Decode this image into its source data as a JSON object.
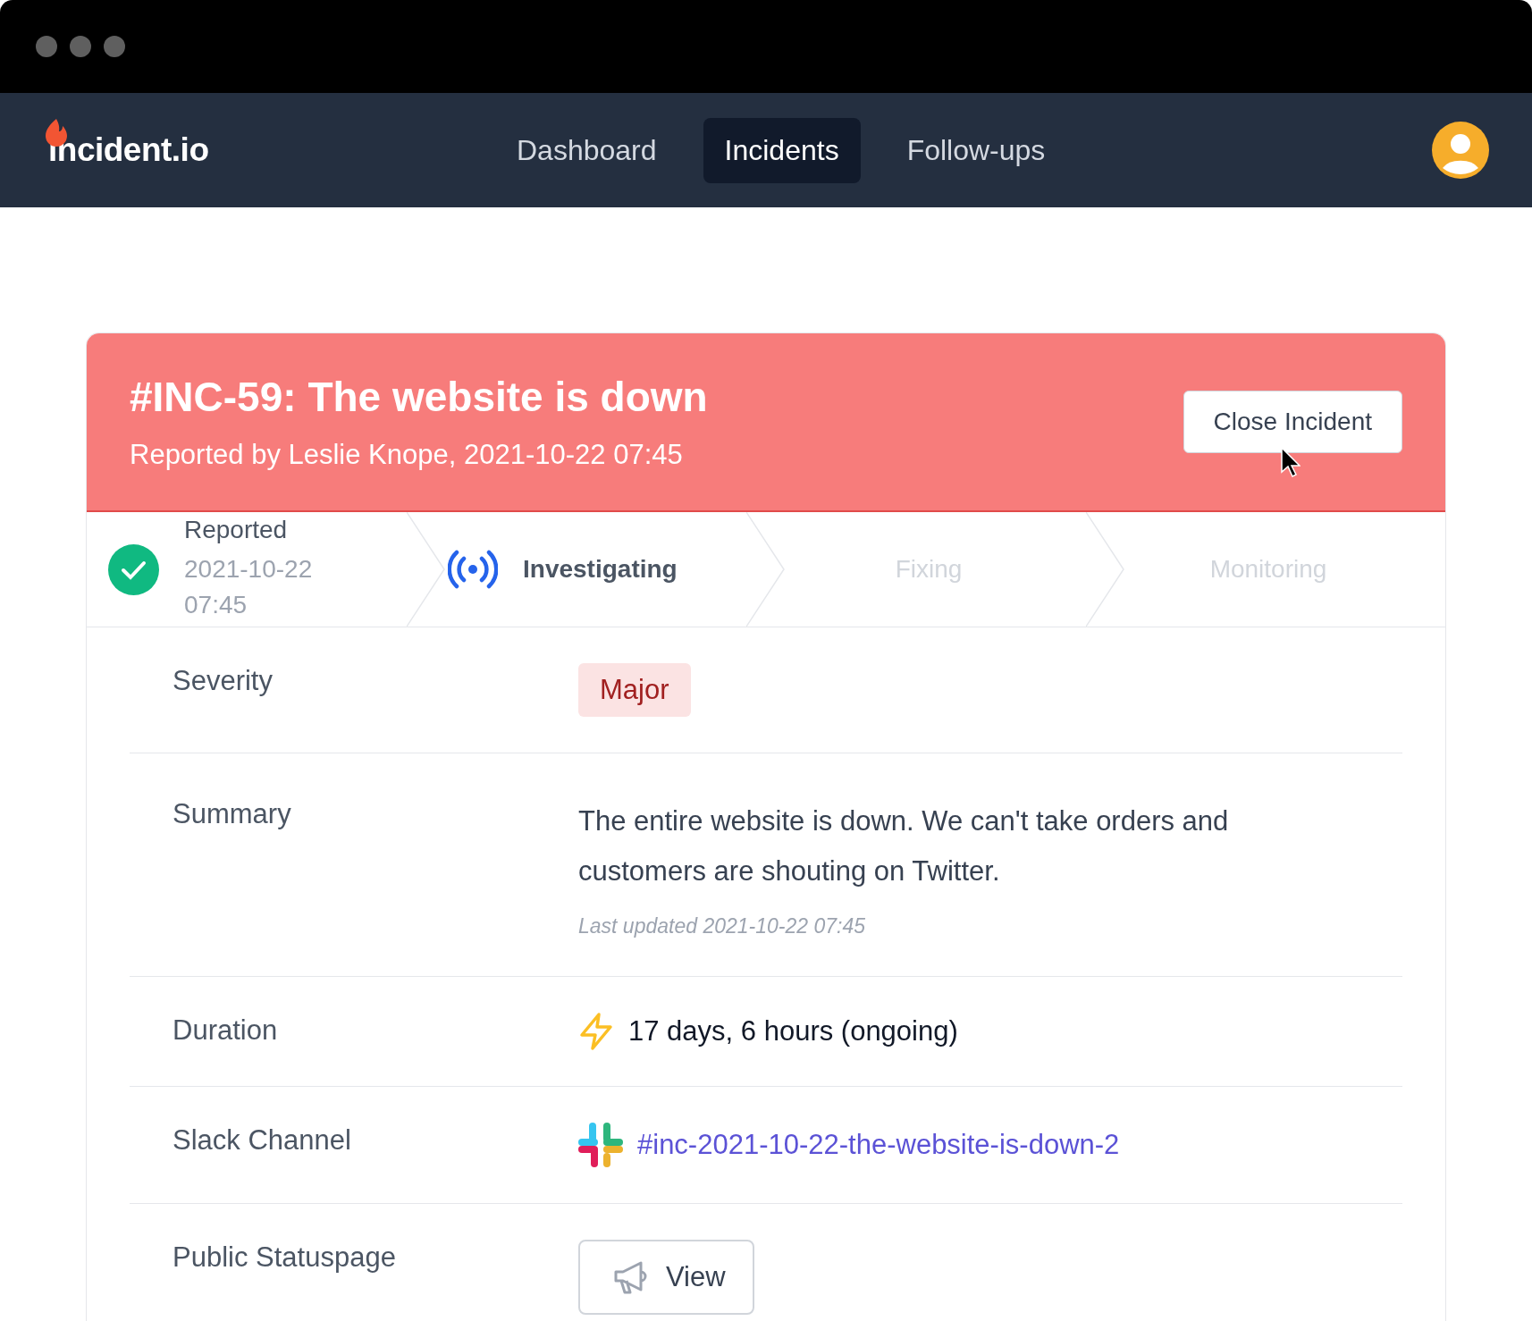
{
  "nav": {
    "logo": "incident.io",
    "items": [
      {
        "label": "Dashboard",
        "selected": false
      },
      {
        "label": "Incidents",
        "selected": true
      },
      {
        "label": "Follow-ups",
        "selected": false
      }
    ]
  },
  "incident": {
    "title": "#INC-59: The website is down",
    "reported": "Reported by Leslie Knope, 2021-10-22 07:45",
    "close_button": "Close Incident"
  },
  "steps": [
    {
      "label": "Reported",
      "kind": "done",
      "date": "2021-10-22 07:45"
    },
    {
      "label": "Investigating",
      "kind": "current"
    },
    {
      "label": "Fixing",
      "kind": "pending"
    },
    {
      "label": "Monitoring",
      "kind": "pending"
    }
  ],
  "fields": [
    {
      "label": "Severity",
      "kind": "badge",
      "value": "Major"
    },
    {
      "label": "Summary",
      "kind": "text",
      "value": "The entire website is down. We can't take orders and customers are shouting on Twitter.",
      "note": "Last updated 2021-10-22 07:45"
    },
    {
      "label": "Duration",
      "kind": "duration",
      "value": "17 days, 6 hours (ongoing)"
    },
    {
      "label": "Slack Channel",
      "kind": "link",
      "value": "#inc-2021-10-22-the-website-is-down-2"
    },
    {
      "label": "Public Statuspage",
      "kind": "button",
      "value": "View"
    }
  ]
}
